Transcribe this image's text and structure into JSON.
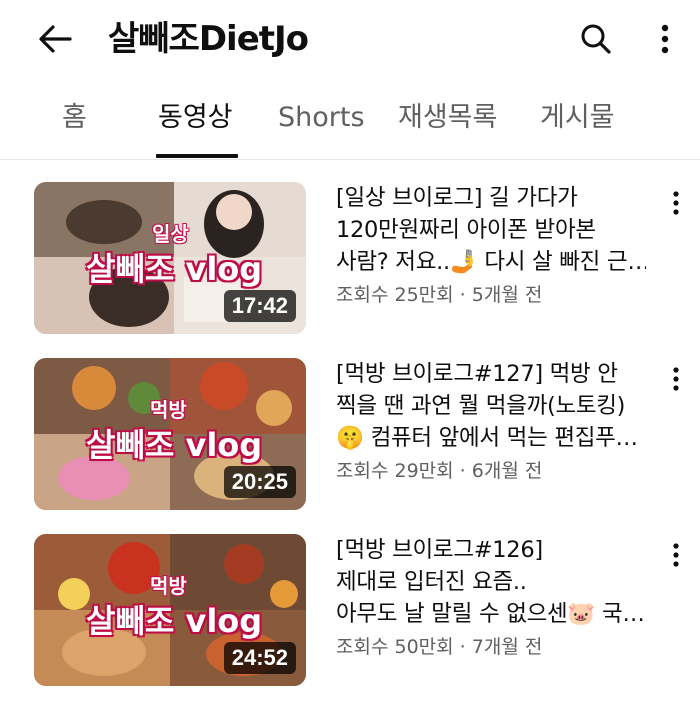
{
  "header": {
    "channel_name": "살빼조DietJo",
    "icons": [
      "back-arrow-icon",
      "search-icon",
      "more-vertical-icon"
    ]
  },
  "tabs": [
    {
      "label": "홈",
      "active": false
    },
    {
      "label": "동영상",
      "active": true
    },
    {
      "label": "Shorts",
      "active": false
    },
    {
      "label": "재생목록",
      "active": false
    },
    {
      "label": "게시물",
      "active": false
    }
  ],
  "videos": [
    {
      "title_lines": [
        "[일상 브이로그] 길 가다가",
        "120만원짜리 아이폰 받아본",
        "사람? 저요..🤳 다시 살 빠진 근…"
      ],
      "views": "조회수 25만회",
      "age": "5개월 전",
      "duration": "17:42",
      "thumb_text": {
        "tag": "일상",
        "main": "살빼조 vlog"
      }
    },
    {
      "title_lines": [
        "[먹방 브이로그#127] 먹방 안",
        "찍을 땐 과연 뭘 먹을까(노토킹)",
        "🤫 컴퓨터 앞에서 먹는 편집푸…"
      ],
      "views": "조회수 29만회",
      "age": "6개월 전",
      "duration": "20:25",
      "thumb_text": {
        "tag": "먹방",
        "main": "살빼조 vlog"
      }
    },
    {
      "title_lines": [
        "[먹방 브이로그#126]",
        "제대로 입터진 요즘..",
        "아무도 날 말릴 수 없으센🐷 국…"
      ],
      "views": "조회수 50만회",
      "age": "7개월 전",
      "duration": "24:52",
      "thumb_text": {
        "tag": "먹방",
        "main": "살빼조 vlog"
      }
    }
  ],
  "meta_separator": " · ",
  "colors": {
    "text_primary": "#0f0f0f",
    "text_secondary": "#606060",
    "thumb_text_outline": "#c2104a"
  }
}
